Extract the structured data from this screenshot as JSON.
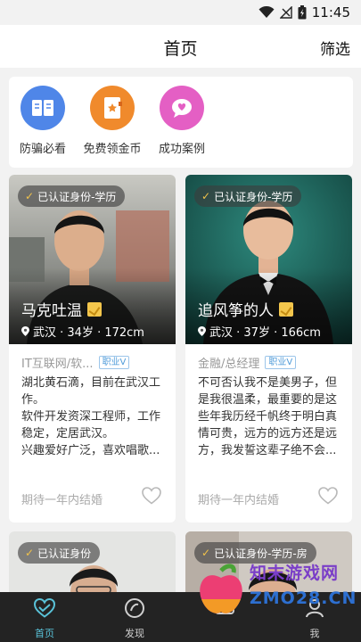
{
  "status_bar": {
    "time": "11:45",
    "icons": [
      "wifi-icon",
      "no-signal-icon",
      "battery-charging-icon"
    ]
  },
  "header": {
    "title": "首页",
    "filter_label": "筛选"
  },
  "quick_actions": [
    {
      "label": "防骗必看",
      "icon": "book-icon",
      "color": "#4f86e8"
    },
    {
      "label": "免费领金币",
      "icon": "notebook-icon",
      "color": "#f08a2c"
    },
    {
      "label": "成功案例",
      "icon": "chat-heart-icon",
      "color": "#e45fc4"
    }
  ],
  "profiles": [
    {
      "verify": "已认证身份-学历",
      "name": "马克吐温",
      "meta": "武汉 · 34岁 · 172cm",
      "job": "IT互联网/软...",
      "job_badge": "职业V",
      "bio": [
        "湖北黄石滴，目前在武汉工",
        "作。",
        "软件开发资深工程师，工作",
        "稳定，定居武汉。",
        "兴趣爱好广泛，喜欢唱歌..."
      ],
      "expect": "期待一年内结婚"
    },
    {
      "verify": "已认证身份-学历",
      "name": "追风筝的人",
      "meta": "武汉 · 37岁 · 166cm",
      "job": "金融/总经理",
      "job_badge": "职业V",
      "bio": [
        "不可否认我不是美男子，但",
        "是我很温柔，最重要的是这",
        "些年我历经千帆终于明白真",
        "情可贵，远方的远方还是远",
        "方，我发誓这辈子绝不会..."
      ],
      "expect": "期待一年内结婚"
    },
    {
      "verify": "已认证身份"
    },
    {
      "verify": "已认证身份-学历-房"
    }
  ],
  "tabs": [
    {
      "label": "首页",
      "icon": "heart-outline-icon",
      "active": true
    },
    {
      "label": "发现",
      "icon": "discover-icon",
      "active": false
    },
    {
      "label": "",
      "icon": "message-icon",
      "active": false
    },
    {
      "label": "我",
      "icon": "user-icon",
      "active": false
    }
  ],
  "watermark": {
    "line1": "知末游戏网",
    "line2": "ZMO28.CN"
  },
  "colors": {
    "accent": "#59c2d8",
    "badge_gold": "#f0c24a"
  }
}
